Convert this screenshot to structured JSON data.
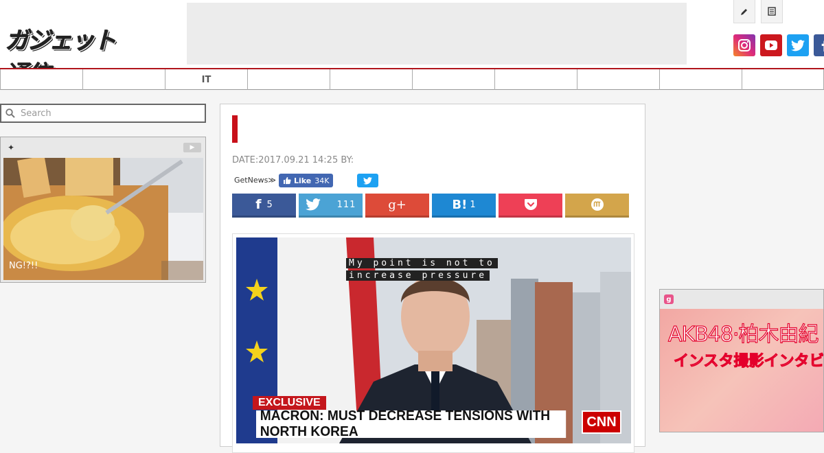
{
  "header": {
    "logo_text": "ガジェット通信",
    "tools": [
      {
        "icon": "pencil-icon"
      },
      {
        "icon": "document-icon"
      }
    ],
    "social": [
      {
        "name": "instagram",
        "color": "#c13584"
      },
      {
        "name": "youtube",
        "color": "#cc181e"
      },
      {
        "name": "twitter",
        "color": "#1da1f2"
      },
      {
        "name": "facebook",
        "color": "#3b5998"
      }
    ]
  },
  "nav": {
    "items": [
      "",
      "",
      "IT",
      "",
      "",
      "",
      "",
      "",
      "",
      ""
    ]
  },
  "sidebar": {
    "search_placeholder": "Search",
    "widget": {
      "head_icon": "✦",
      "caption": "NG!?!!"
    }
  },
  "article": {
    "meta": "DATE:2017.09.21 14:25 BY:",
    "getnews_label": "GetNews≫",
    "fb_like_label": "Like",
    "fb_like_count": "34K",
    "share": [
      {
        "name": "facebook",
        "label": "f",
        "count": "5",
        "color": "#3b5998"
      },
      {
        "name": "twitter",
        "label": "",
        "count": "111",
        "color": "#4ba3d5"
      },
      {
        "name": "googleplus",
        "label": "g+",
        "count": "",
        "color": "#dd4b39"
      },
      {
        "name": "hatena",
        "label": "B!",
        "count": "1",
        "color": "#1e88d3"
      },
      {
        "name": "pocket",
        "label": "",
        "count": "",
        "color": "#ee4056"
      },
      {
        "name": "mixi",
        "label": "",
        "count": "",
        "color": "#d3a54b"
      }
    ],
    "photo": {
      "subtitle_line1": "My point is not to",
      "subtitle_line2": "increase pressure",
      "exclusive": "EXCLUSIVE",
      "headline": "MACRON: MUST DECREASE TENSIONS WITH NORTH KOREA",
      "network": "CNN"
    }
  },
  "right_widget": {
    "icon": "g",
    "line1": "AKB48·柏木由紀",
    "line2": "インスタ撮影インタビ"
  }
}
